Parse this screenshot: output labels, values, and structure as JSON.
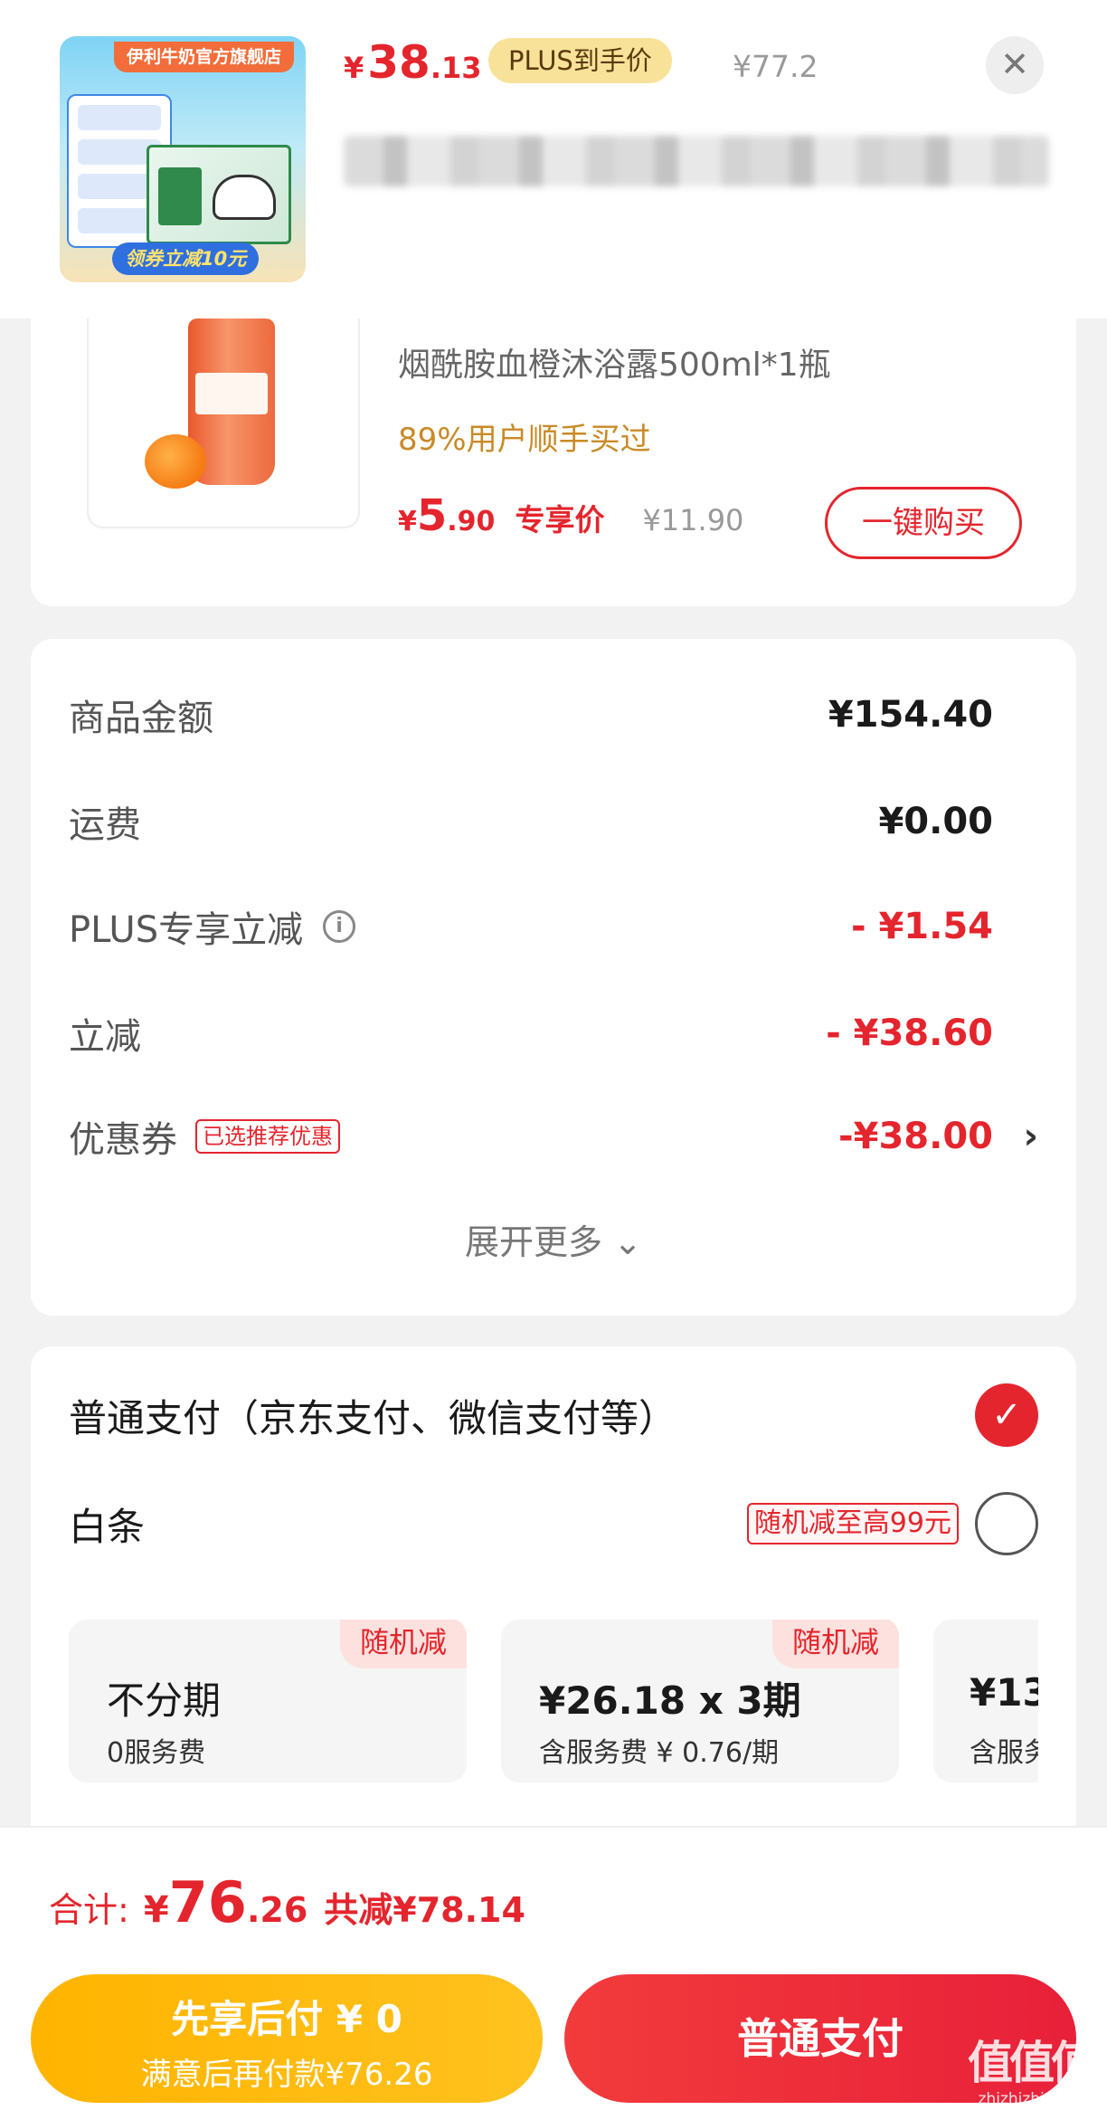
{
  "header": {
    "thumb": {
      "store_name": "伊利牛奶官方旗舰店",
      "coupon_text": "领券立减10元"
    },
    "price": {
      "yen": "¥",
      "integer": "38",
      "decimal": ".13"
    },
    "plus_badge": "PLUS到手价",
    "original_price": "¥77.2",
    "close_glyph": "✕"
  },
  "recommend": {
    "title": "烟酰胺血橙沐浴露500ml*1瓶",
    "bought_text": "89%用户顺手买过",
    "price": {
      "yen": "¥",
      "integer": "5",
      "decimal": ".90"
    },
    "price_tag": "专享价",
    "original_price": "¥11.90",
    "buy_button": "一键购买"
  },
  "costs": {
    "rows": [
      {
        "label": "商品金额",
        "value": "¥154.40"
      },
      {
        "label": "运费",
        "value": "¥0.00"
      },
      {
        "label": "PLUS专享立减",
        "value": "- ¥1.54",
        "info_glyph": "i"
      },
      {
        "label": "立减",
        "value": "- ¥38.60"
      },
      {
        "label": "优惠券",
        "value": "-¥38.00",
        "tag": "已选推荐优惠",
        "chevron": "›"
      }
    ],
    "expand_label": "展开更多 ⌄"
  },
  "payment": {
    "normal": {
      "label": "普通支付（京东支付、微信支付等）",
      "selected": true,
      "check_glyph": "✓"
    },
    "baitiao": {
      "label": "白条",
      "promo": "随机减至高99元",
      "selected": false
    },
    "plans": [
      {
        "corner": "随机减",
        "main": "不分期",
        "sub": "0服务费"
      },
      {
        "corner": "随机减",
        "main": "¥26.18 x 3期",
        "sub": "含服务费 ¥ 0.76/期"
      },
      {
        "corner": "",
        "main": "¥13",
        "sub": "含服务"
      }
    ]
  },
  "total": {
    "label": "合计:",
    "yen": "¥",
    "integer": "76",
    "decimal": ".26",
    "saved": "共减¥78.14"
  },
  "actions": {
    "pay_later_line1": "先享后付 ¥ 0",
    "pay_later_line2": "满意后再付款¥76.26",
    "pay_normal": "普通支付"
  },
  "watermark": {
    "big": "值值值",
    "small": "zhizhizhi.com"
  },
  "colors": {
    "accent_red": "#e4252d",
    "gold": "#c98a26",
    "plus_badge_bg": "#f8e29a",
    "pay_later_yellow": "#ffb400"
  }
}
